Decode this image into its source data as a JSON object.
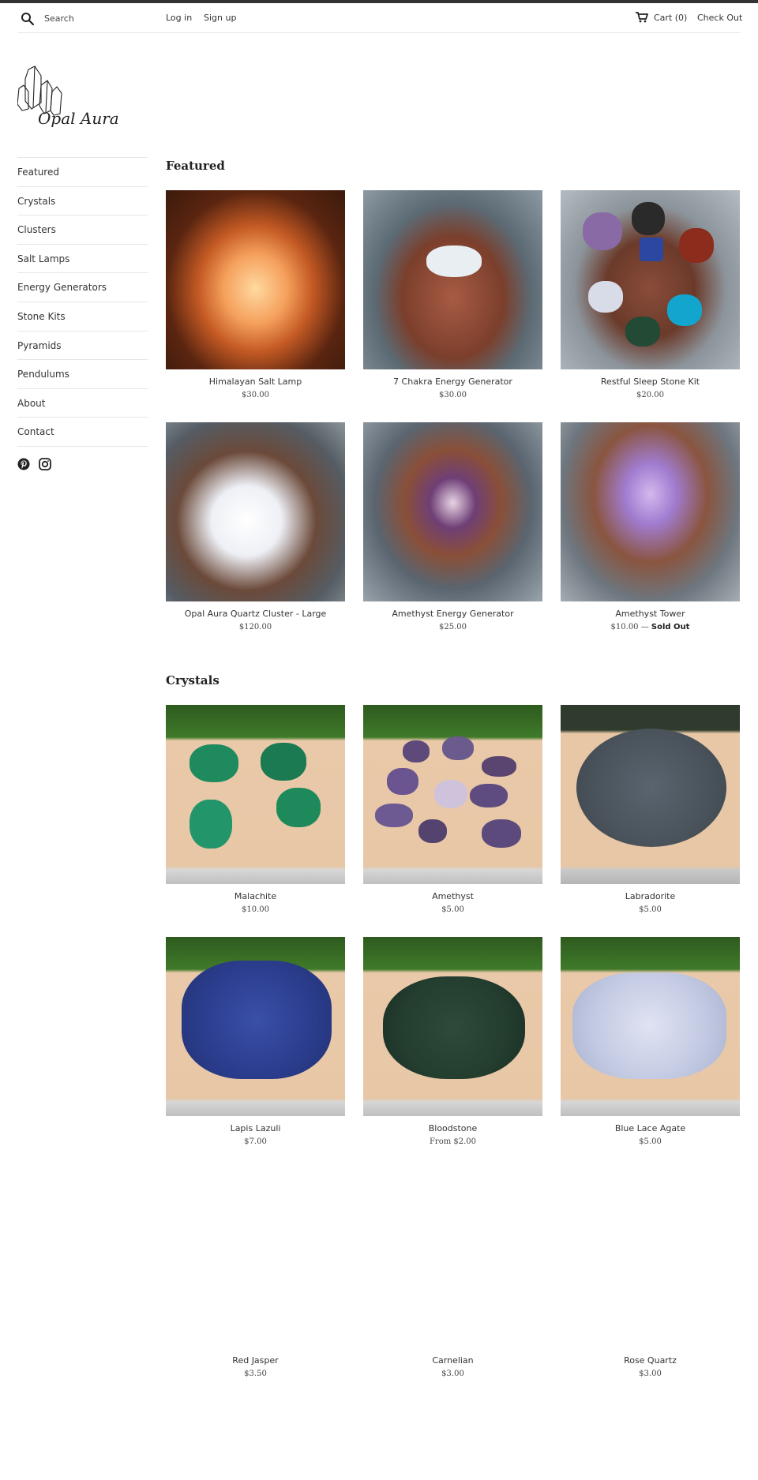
{
  "header": {
    "search_placeholder": "Search",
    "login": "Log in",
    "signup": "Sign up",
    "cart": "Cart (0)",
    "checkout": "Check Out"
  },
  "brand": {
    "name": "Opal Aura"
  },
  "sidebar": {
    "items": [
      {
        "label": "Featured"
      },
      {
        "label": "Crystals"
      },
      {
        "label": "Clusters"
      },
      {
        "label": "Salt Lamps"
      },
      {
        "label": "Energy Generators"
      },
      {
        "label": "Stone Kits"
      },
      {
        "label": "Pyramids"
      },
      {
        "label": "Pendulums"
      },
      {
        "label": "About"
      },
      {
        "label": "Contact"
      }
    ],
    "social": [
      "pinterest-icon",
      "instagram-icon"
    ]
  },
  "featured": {
    "title": "Featured",
    "products": [
      {
        "name": "Himalayan Salt Lamp",
        "price": "$30.00"
      },
      {
        "name": "7 Chakra Energy Generator",
        "price": "$30.00"
      },
      {
        "name": "Restful Sleep Stone Kit",
        "price": "$20.00"
      },
      {
        "name": "Opal Aura Quartz Cluster - Large",
        "price": "$120.00"
      },
      {
        "name": "Amethyst Energy Generator",
        "price": "$25.00"
      },
      {
        "name": "Amethyst Tower",
        "price": "$10.00",
        "sold_sep": " — ",
        "sold": "Sold Out"
      }
    ]
  },
  "crystals": {
    "title": "Crystals",
    "products": [
      {
        "name": "Malachite",
        "price": "$10.00"
      },
      {
        "name": "Amethyst",
        "price": "$5.00"
      },
      {
        "name": "Labradorite",
        "price": "$5.00"
      },
      {
        "name": "Lapis Lazuli",
        "price": "$7.00"
      },
      {
        "name": "Bloodstone",
        "price": "From $2.00"
      },
      {
        "name": "Blue Lace Agate",
        "price": "$5.00"
      },
      {
        "name": "Red Jasper",
        "price": "$3.50"
      },
      {
        "name": "Carnelian",
        "price": "$3.00"
      },
      {
        "name": "Rose Quartz",
        "price": "$3.00"
      }
    ]
  },
  "colors": {
    "topbar": "#333333",
    "text": "#333333",
    "divider": "#e6e6e6"
  }
}
